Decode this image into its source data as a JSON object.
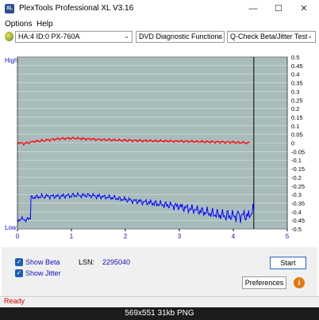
{
  "window": {
    "title": "PlexTools Professional XL V3.16",
    "app_icon_text": "XL",
    "minimize_glyph": "—",
    "maximize_glyph": "☐",
    "close_glyph": "✕"
  },
  "menu": {
    "items": [
      "Options",
      "Help"
    ]
  },
  "toolbar": {
    "drive": "HA:4 ID:0  PX-760A",
    "function": "DVD Diagnostic Functions",
    "test": "Q-Check Beta/Jitter Test"
  },
  "chart_data": {
    "type": "line",
    "y_left_labels": {
      "high": "High",
      "low": "Low"
    },
    "x_ticks": [
      "0",
      "1",
      "2",
      "3",
      "4",
      "5"
    ],
    "xlim": [
      0,
      5
    ],
    "y_right_ticks": [
      "0.5",
      "0.45",
      "0.4",
      "0.35",
      "0.3",
      "0.25",
      "0.2",
      "0.15",
      "0.1",
      "0.05",
      "0",
      "-0.05",
      "-0.1",
      "-0.15",
      "-0.2",
      "-0.25",
      "-0.3",
      "-0.35",
      "-0.4",
      "-0.45",
      "-0.5"
    ],
    "ylim": [
      -0.5,
      0.5
    ],
    "end_marker_x": 4.38,
    "background_color": "#a9bcbc",
    "series": [
      {
        "color": "#ff0000",
        "x": [
          0.0,
          0.1,
          0.3,
          0.5,
          0.8,
          1.0,
          1.2,
          1.5,
          2.0,
          2.5,
          3.0,
          3.5,
          4.0,
          4.3
        ],
        "y": [
          0.005,
          -0.005,
          0.008,
          0.015,
          0.025,
          0.028,
          0.025,
          0.02,
          0.015,
          0.012,
          0.01,
          0.007,
          0.004,
          0.0
        ]
      },
      {
        "color": "#0000ff",
        "x": [
          0.0,
          0.24,
          0.25,
          0.3,
          0.5,
          0.8,
          1.0,
          1.3,
          1.5,
          1.8,
          2.0,
          2.5,
          3.0,
          3.3,
          3.6,
          3.9,
          4.1,
          4.3,
          4.38
        ],
        "y": [
          -0.445,
          -0.445,
          -0.32,
          -0.315,
          -0.31,
          -0.31,
          -0.305,
          -0.305,
          -0.31,
          -0.32,
          -0.33,
          -0.35,
          -0.37,
          -0.39,
          -0.41,
          -0.425,
          -0.425,
          -0.42,
          -0.39
        ]
      }
    ]
  },
  "options": {
    "show_beta_label": "Show Beta",
    "show_jitter_label": "Show Jitter",
    "show_beta_checked": true,
    "show_jitter_checked": true,
    "lsn_label": "LSN:",
    "lsn_value": "2295040",
    "start_label": "Start",
    "preferences_label": "Preferences",
    "info_glyph": "i"
  },
  "status": {
    "text": "Ready"
  },
  "caption": {
    "text": "569x551  31kb  PNG"
  }
}
